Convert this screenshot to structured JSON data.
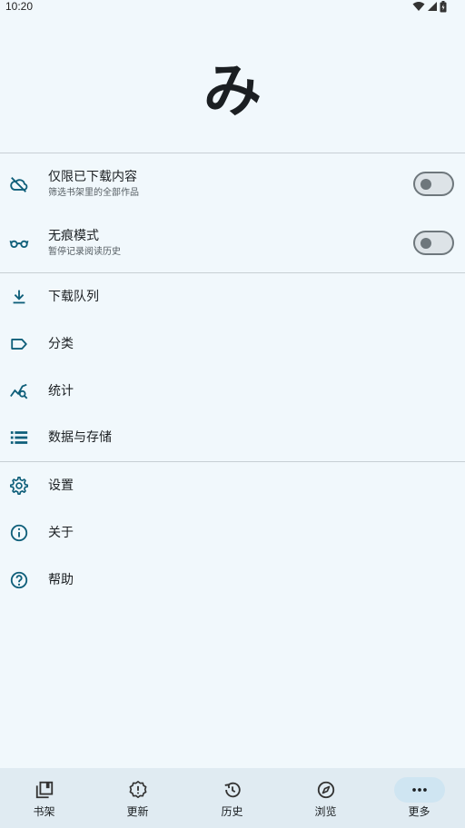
{
  "status_bar": {
    "time": "10:20",
    "icons": [
      "wifi-icon",
      "signal-icon",
      "battery-icon"
    ]
  },
  "header": {
    "logo_text": "み"
  },
  "toggles": [
    {
      "title": "仅限已下载内容",
      "subtitle": "筛选书架里的全部作品",
      "icon": "cloud-off-icon",
      "enabled": false
    },
    {
      "title": "无痕模式",
      "subtitle": "暂停记录阅读历史",
      "icon": "glasses-icon",
      "enabled": false
    }
  ],
  "menu_group_1": [
    {
      "label": "下载队列",
      "icon": "download-icon"
    },
    {
      "label": "分类",
      "icon": "label-icon"
    },
    {
      "label": "统计",
      "icon": "query-stats-icon"
    },
    {
      "label": "数据与存储",
      "icon": "storage-list-icon"
    }
  ],
  "menu_group_2": [
    {
      "label": "设置",
      "icon": "gear-icon"
    },
    {
      "label": "关于",
      "icon": "info-icon"
    },
    {
      "label": "帮助",
      "icon": "help-icon"
    }
  ],
  "bottom_nav": {
    "items": [
      {
        "label": "书架",
        "icon": "library-icon"
      },
      {
        "label": "更新",
        "icon": "new-releases-icon"
      },
      {
        "label": "历史",
        "icon": "history-icon"
      },
      {
        "label": "浏览",
        "icon": "compass-icon"
      },
      {
        "label": "更多",
        "icon": "more-horiz-icon"
      }
    ],
    "active_index": 4
  },
  "colors": {
    "background": "#f1f8fc",
    "accent": "#0f5f7a",
    "nav_background": "#e0ebf2",
    "nav_active_pill": "#cfe5f2"
  }
}
